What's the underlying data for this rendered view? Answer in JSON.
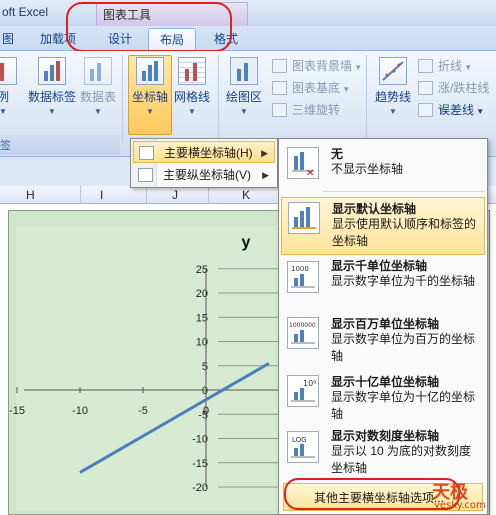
{
  "window": {
    "app_title": "oft Excel",
    "context_tools": "图表工具"
  },
  "tabs": {
    "left_partial": "图",
    "items": [
      "加载项",
      "设计",
      "布局",
      "格式"
    ],
    "active": "布局"
  },
  "ribbon": {
    "buttons": [
      {
        "label": "例"
      },
      {
        "label": "数据标签"
      },
      {
        "label": "数据表"
      },
      {
        "label": "坐标轴"
      },
      {
        "label": "网格线"
      },
      {
        "label": "绘图区"
      },
      {
        "label": "趋势线"
      }
    ],
    "small_items": [
      "图表背景墙",
      "图表基底",
      "三维旋转",
      "折线",
      "涨/跌柱线",
      "误差线"
    ],
    "group_label": "签"
  },
  "submenu": {
    "items": [
      {
        "label": "主要横坐标轴(H)",
        "active": true
      },
      {
        "label": "主要纵坐标轴(V)",
        "active": false
      }
    ]
  },
  "panel": {
    "items": [
      {
        "title": "无",
        "desc": "不显示坐标轴",
        "icon": "no-axis-icon"
      },
      {
        "title": "显示默认坐标轴",
        "desc": "显示使用默认顺序和标签的坐标轴",
        "icon": "default-axis-icon"
      },
      {
        "title": "显示千单位坐标轴",
        "desc": "显示数字单位为千的坐标轴",
        "icon": "thousands-axis-icon",
        "badge": "1000"
      },
      {
        "title": "显示百万单位坐标轴",
        "desc": "显示数字单位为百万的坐标轴",
        "icon": "millions-axis-icon",
        "badge": "1000000"
      },
      {
        "title": "显示十亿单位坐标轴",
        "desc": "显示数字单位为十亿的坐标轴",
        "icon": "billions-axis-icon",
        "badge": "10⁹"
      },
      {
        "title": "显示对数刻度坐标轴",
        "desc": "显示以 10 为底的对数刻度坐标轴",
        "icon": "log-axis-icon",
        "badge": "LOG"
      }
    ],
    "more_options": "其他主要横坐标轴选项..."
  },
  "columns": [
    "H",
    "I",
    "J",
    "K"
  ],
  "chart_data": {
    "type": "line",
    "title": "y",
    "x_ticks": [
      "-15",
      "-10",
      "-5",
      "0"
    ],
    "y_ticks": [
      "25",
      "20",
      "15",
      "10",
      "5",
      "0",
      "-5",
      "-10",
      "-15",
      "-20"
    ],
    "xlim": [
      -15,
      5
    ],
    "ylim": [
      -20,
      25
    ],
    "series": [
      {
        "x": [
          -10,
          5
        ],
        "y": [
          -17,
          5.5
        ],
        "color": "#4a7ebb"
      }
    ]
  },
  "watermark": {
    "logo": "天极",
    "site": "yesky.com"
  }
}
